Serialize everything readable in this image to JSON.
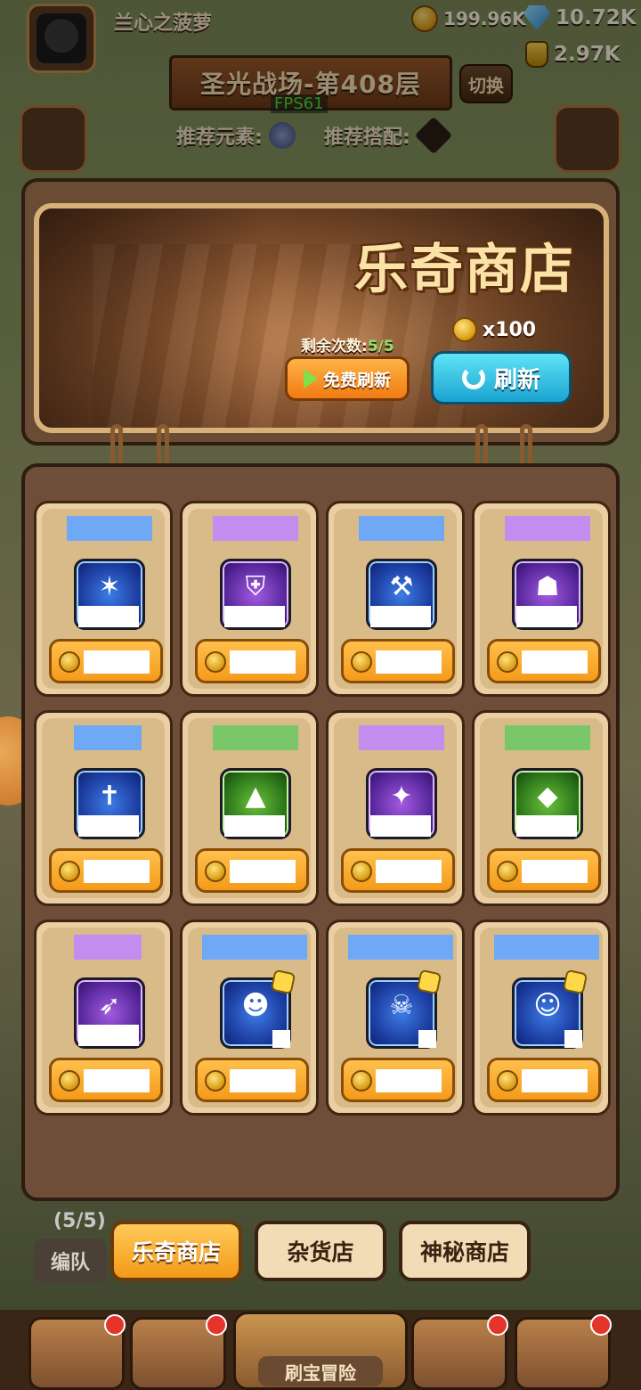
{
  "top_bar": {
    "player_name": "兰心之菠萝",
    "gold": "199.96K",
    "gems": "10.72K",
    "energy": "2.97K"
  },
  "stage": {
    "title": "圣光战场-第408层",
    "switch_label": "切换",
    "fps": "FPS61",
    "recommend_element_label": "推荐元素:",
    "recommend_combo_label": "推荐搭配:"
  },
  "shop": {
    "title": "乐奇商店",
    "refresh_cost": "x100",
    "remaining_label": "剩余次数:",
    "remaining_value": "5/5",
    "free_refresh_label": "免费刷新",
    "refresh_label": "刷新",
    "items": [
      {
        "rarity": "blue",
        "color": "#6fa8f5",
        "icon": "starfish-flower-icon"
      },
      {
        "rarity": "purple",
        "color": "#c58cf0",
        "icon": "golden-armor-icon"
      },
      {
        "rarity": "blue",
        "color": "#6fa8f5",
        "icon": "shovel-icon"
      },
      {
        "rarity": "purple",
        "color": "#c58cf0",
        "icon": "camo-cloak-icon"
      },
      {
        "rarity": "blue",
        "color": "#6fa8f5",
        "icon": "crossbow-icon"
      },
      {
        "rarity": "green",
        "color": "#7ac76a",
        "icon": "tent-icon"
      },
      {
        "rarity": "purple",
        "color": "#c58cf0",
        "icon": "magic-staff-icon"
      },
      {
        "rarity": "green",
        "color": "#7ac76a",
        "icon": "crystal-shard-icon"
      },
      {
        "rarity": "purple",
        "color": "#c58cf0",
        "icon": "swordfish-icon"
      },
      {
        "rarity": "blue",
        "color": "#6fa8f5",
        "icon": "hooded-hero-icon"
      },
      {
        "rarity": "blue",
        "color": "#6fa8f5",
        "icon": "pirate-hero-icon"
      },
      {
        "rarity": "blue",
        "color": "#6fa8f5",
        "icon": "redhead-hero-icon"
      }
    ]
  },
  "tabs": [
    {
      "label": "乐奇商店",
      "active": true
    },
    {
      "label": "杂货店",
      "active": false
    },
    {
      "label": "神秘商店",
      "active": false
    }
  ],
  "team": {
    "count": "(5/5)",
    "label": "编队"
  },
  "bottom_nav": {
    "center_label": "刷宝冒险"
  }
}
